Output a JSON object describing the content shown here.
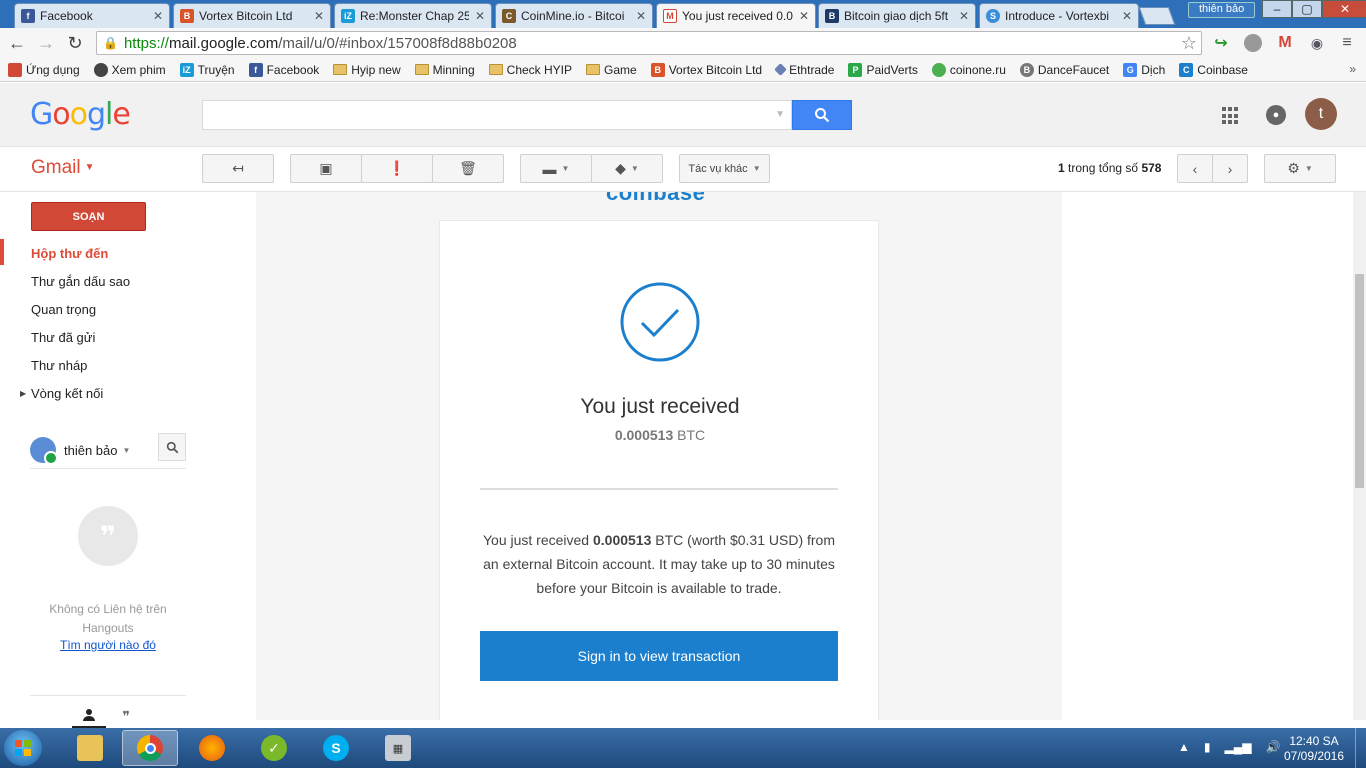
{
  "browser": {
    "tabs": [
      {
        "title": "Facebook",
        "icon": "facebook-icon",
        "color": "#3b5998",
        "glyph": "f"
      },
      {
        "title": "Vortex Bitcoin Ltd",
        "icon": "vortex-icon",
        "color": "#d9542b",
        "glyph": "B"
      },
      {
        "title": "Re:Monster Chap 25",
        "icon": "truyen-icon",
        "color": "#1a9bd7",
        "glyph": "iZ"
      },
      {
        "title": "CoinMine.io - Bitcoi",
        "icon": "coinmine-icon",
        "color": "#7a5a2a",
        "glyph": "C"
      },
      {
        "title": "You just received 0.0",
        "icon": "gmail-icon",
        "color": "#d14836",
        "glyph": "M"
      },
      {
        "title": "Bitcoin giao dịch 5ft",
        "icon": "bitcoin-exchange-icon",
        "color": "#1e3a66",
        "glyph": "B"
      },
      {
        "title": "Introduce - Vortexbi",
        "icon": "vortex-s-icon",
        "color": "#3a8fd8",
        "glyph": "S"
      }
    ],
    "window_user": "thiên bảo",
    "url": {
      "scheme": "https://",
      "host": "mail.google.com",
      "path": "/mail/u/0/#inbox/157008f8d88b0208"
    },
    "bookmarks": [
      {
        "label": "Ứng dụng",
        "icon": "apps-grid-icon"
      },
      {
        "label": "Xem phim",
        "icon": "film-icon"
      },
      {
        "label": "Truyện",
        "icon": "truyen-icon"
      },
      {
        "label": "Facebook",
        "icon": "facebook-icon"
      },
      {
        "label": "Hyip new",
        "icon": "folder-icon"
      },
      {
        "label": "Minning",
        "icon": "folder-icon"
      },
      {
        "label": "Check HYIP",
        "icon": "folder-icon"
      },
      {
        "label": "Game",
        "icon": "folder-icon"
      },
      {
        "label": "Vortex Bitcoin Ltd",
        "icon": "vortex-icon"
      },
      {
        "label": "Ethtrade",
        "icon": "ethereum-icon"
      },
      {
        "label": "PaidVerts",
        "icon": "paidverts-icon"
      },
      {
        "label": "coinone.ru",
        "icon": "coinone-icon"
      },
      {
        "label": "DanceFaucet",
        "icon": "dancefaucet-icon"
      },
      {
        "label": "Dịch",
        "icon": "translate-icon"
      },
      {
        "label": "Coinbase",
        "icon": "coinbase-icon"
      }
    ],
    "bookmarks_more": "»"
  },
  "gmail": {
    "logo": "Google",
    "app_label": "Gmail",
    "toolbar": {
      "more_actions": "Tác vụ khác"
    },
    "pager": {
      "range": "1",
      "text": "trong tổng số",
      "total": "578"
    },
    "compose": "SOẠN",
    "nav": [
      "Hộp thư đến",
      "Thư gắn dấu sao",
      "Quan trọng",
      "Thư đã gửi",
      "Thư nháp",
      "Vòng kết nối"
    ],
    "hangouts": {
      "user": "thiên bảo",
      "empty_line1": "Không có Liên hệ trên",
      "empty_line2": "Hangouts",
      "find_link": "Tìm người nào đó"
    },
    "avatar_letter": "t"
  },
  "email": {
    "brand": "coinbase",
    "headline": "You just received",
    "amount": "0.000513",
    "currency": "BTC",
    "body_pre": "You just received ",
    "body_amount": "0.000513",
    "body_post": " BTC (worth $0.31 USD) from an external Bitcoin account. It may take up to 30 minutes before your Bitcoin is available to trade.",
    "cta": "Sign in to view transaction"
  },
  "taskbar": {
    "time": "12:40 SA",
    "date": "07/09/2016"
  },
  "colors": {
    "gmail_red": "#dd4b39",
    "coinbase_blue": "#1b7fcd",
    "google_blue": "#4285f4"
  }
}
